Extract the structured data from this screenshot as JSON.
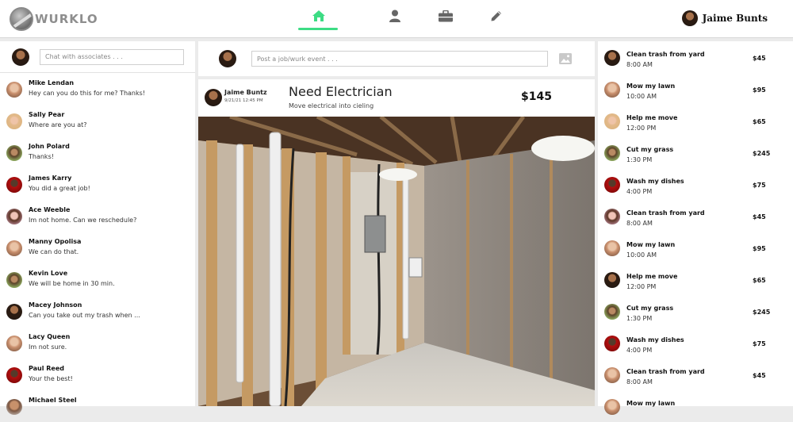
{
  "app": {
    "logo_text": "WURKLO"
  },
  "header": {
    "nav": [
      {
        "icon": "home-icon",
        "active": true
      },
      {
        "icon": "person-icon",
        "active": false
      },
      {
        "icon": "briefcase-icon",
        "active": false
      },
      {
        "icon": "pencil-icon",
        "active": false
      }
    ],
    "user_name": "Jaime Bunts",
    "accent": "#3ddc84"
  },
  "chat": {
    "placeholder": "Chat with associates . . .",
    "messages": [
      {
        "name": "Mike Lendan",
        "text": "Hey can you do this for me? Thanks!"
      },
      {
        "name": "Sally Pear",
        "text": "Where are you at?"
      },
      {
        "name": "John Polard",
        "text": "Thanks!"
      },
      {
        "name": "James Karry",
        "text": "You did a great job!"
      },
      {
        "name": "Ace Weeble",
        "text": "Im not home. Can we reschedule?"
      },
      {
        "name": "Manny Opolisa",
        "text": "We can do that."
      },
      {
        "name": "Kevin Love",
        "text": "We will be home in 30 min."
      },
      {
        "name": "Macey Johnson",
        "text": "Can you take out my trash when ..."
      },
      {
        "name": "Lacy Queen",
        "text": "Im not sure."
      },
      {
        "name": "Paul Reed",
        "text": "Your the best!"
      },
      {
        "name": "Michael Steel",
        "text": ""
      }
    ]
  },
  "post": {
    "placeholder": "Post a job/wurk event . . ."
  },
  "card": {
    "poster_name": "Jaime Buntz",
    "date": "9/21/21 12:45 PM",
    "title": "Need Electrician",
    "description": "Move electrical into cieling",
    "price": "$145"
  },
  "jobs": [
    {
      "title": "Clean trash from yard",
      "time": "8:00 AM",
      "amount": "$45"
    },
    {
      "title": "Mow my lawn",
      "time": "10:00 AM",
      "amount": "$95"
    },
    {
      "title": "Help me move",
      "time": "12:00 PM",
      "amount": "$65"
    },
    {
      "title": "Cut my grass",
      "time": "1:30 PM",
      "amount": "$245"
    },
    {
      "title": "Wash my dishes",
      "time": "4:00 PM",
      "amount": "$75"
    },
    {
      "title": "Clean trash from yard",
      "time": "8:00 AM",
      "amount": "$45"
    },
    {
      "title": "Mow my lawn",
      "time": "10:00 AM",
      "amount": "$95"
    },
    {
      "title": "Help me move",
      "time": "12:00 PM",
      "amount": "$65"
    },
    {
      "title": "Cut my grass",
      "time": "1:30 PM",
      "amount": "$245"
    },
    {
      "title": "Wash my dishes",
      "time": "4:00 PM",
      "amount": "$75"
    },
    {
      "title": "Clean trash from yard",
      "time": "8:00 AM",
      "amount": "$45"
    },
    {
      "title": "Mow my lawn",
      "time": "",
      "amount": ""
    }
  ]
}
